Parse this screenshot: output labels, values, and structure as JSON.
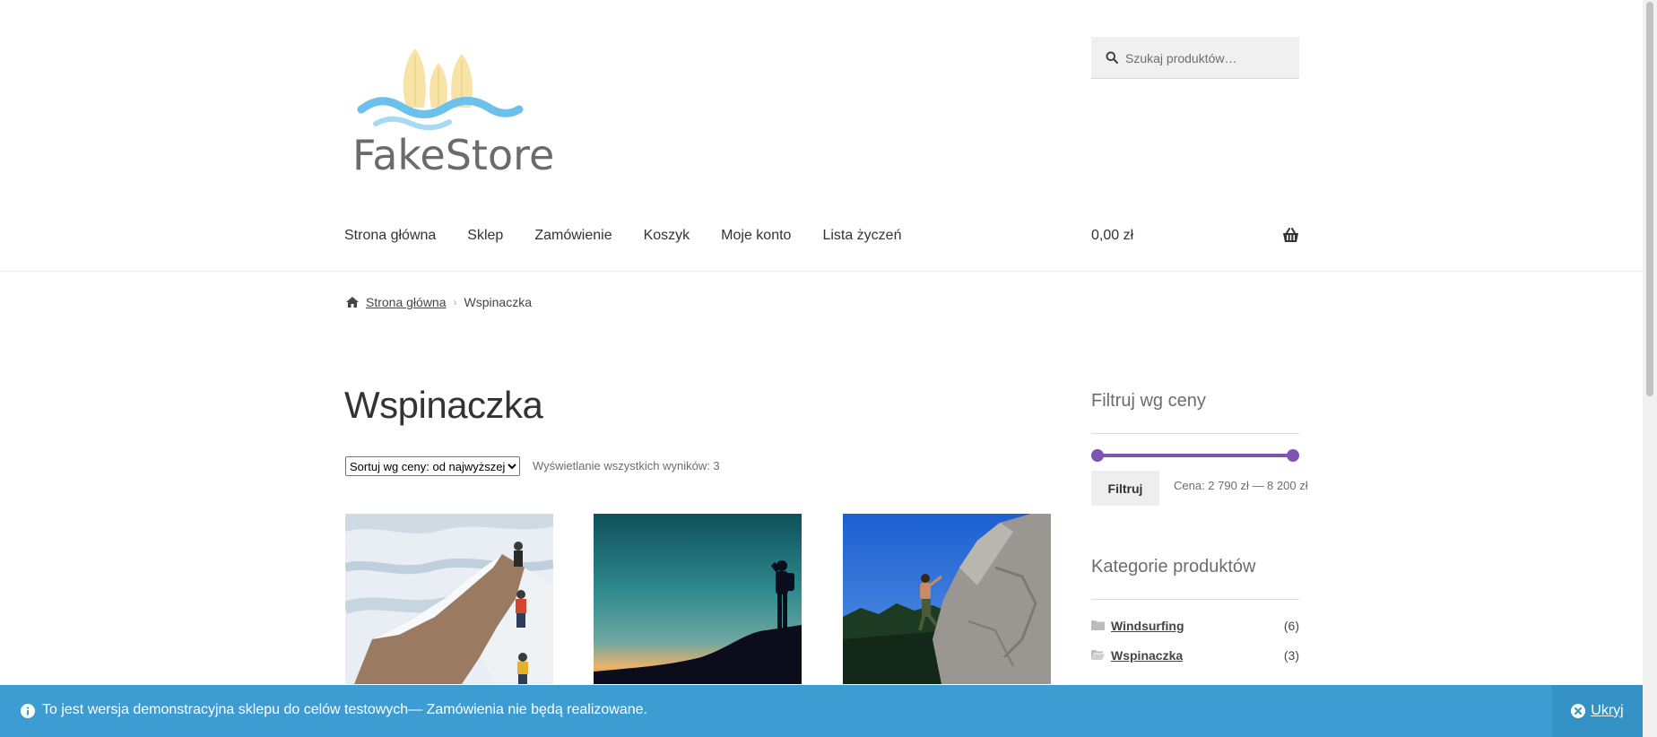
{
  "header": {
    "logo_text": "FakeStore",
    "search": {
      "placeholder": "Szukaj produktów…"
    },
    "nav": [
      "Strona główna",
      "Sklep",
      "Zamówienie",
      "Koszyk",
      "Moje konto",
      "Lista życzeń"
    ],
    "cart_total": "0,00 zł"
  },
  "breadcrumb": {
    "home": "Strona główna",
    "current": "Wspinaczka"
  },
  "main": {
    "title": "Wspinaczka",
    "sort_selected": "Sortuj wg ceny: od najwyższej",
    "results": "Wyświetlanie wszystkich wyników: 3"
  },
  "sidebar": {
    "price_filter": {
      "title": "Filtruj wg ceny",
      "button": "Filtruj",
      "label": "Cena: 2 790 zł — 8 200 zł",
      "selected_min_fraction": 0,
      "selected_max_fraction": 1
    },
    "categories": {
      "title": "Kategorie produktów",
      "items": [
        {
          "name": "Windsurfing",
          "count": "(6)"
        },
        {
          "name": "Wspinaczka",
          "count": "(3)"
        }
      ]
    }
  },
  "notice": {
    "text": "To jest wersja demonstracyjna sklepu do celów testowych— Zamówienia nie będą realizowane.",
    "dismiss": "Ukryj"
  },
  "colors": {
    "accent": "#7f54b3",
    "notice_bg": "#3d9cd2",
    "text": "#43454b"
  }
}
